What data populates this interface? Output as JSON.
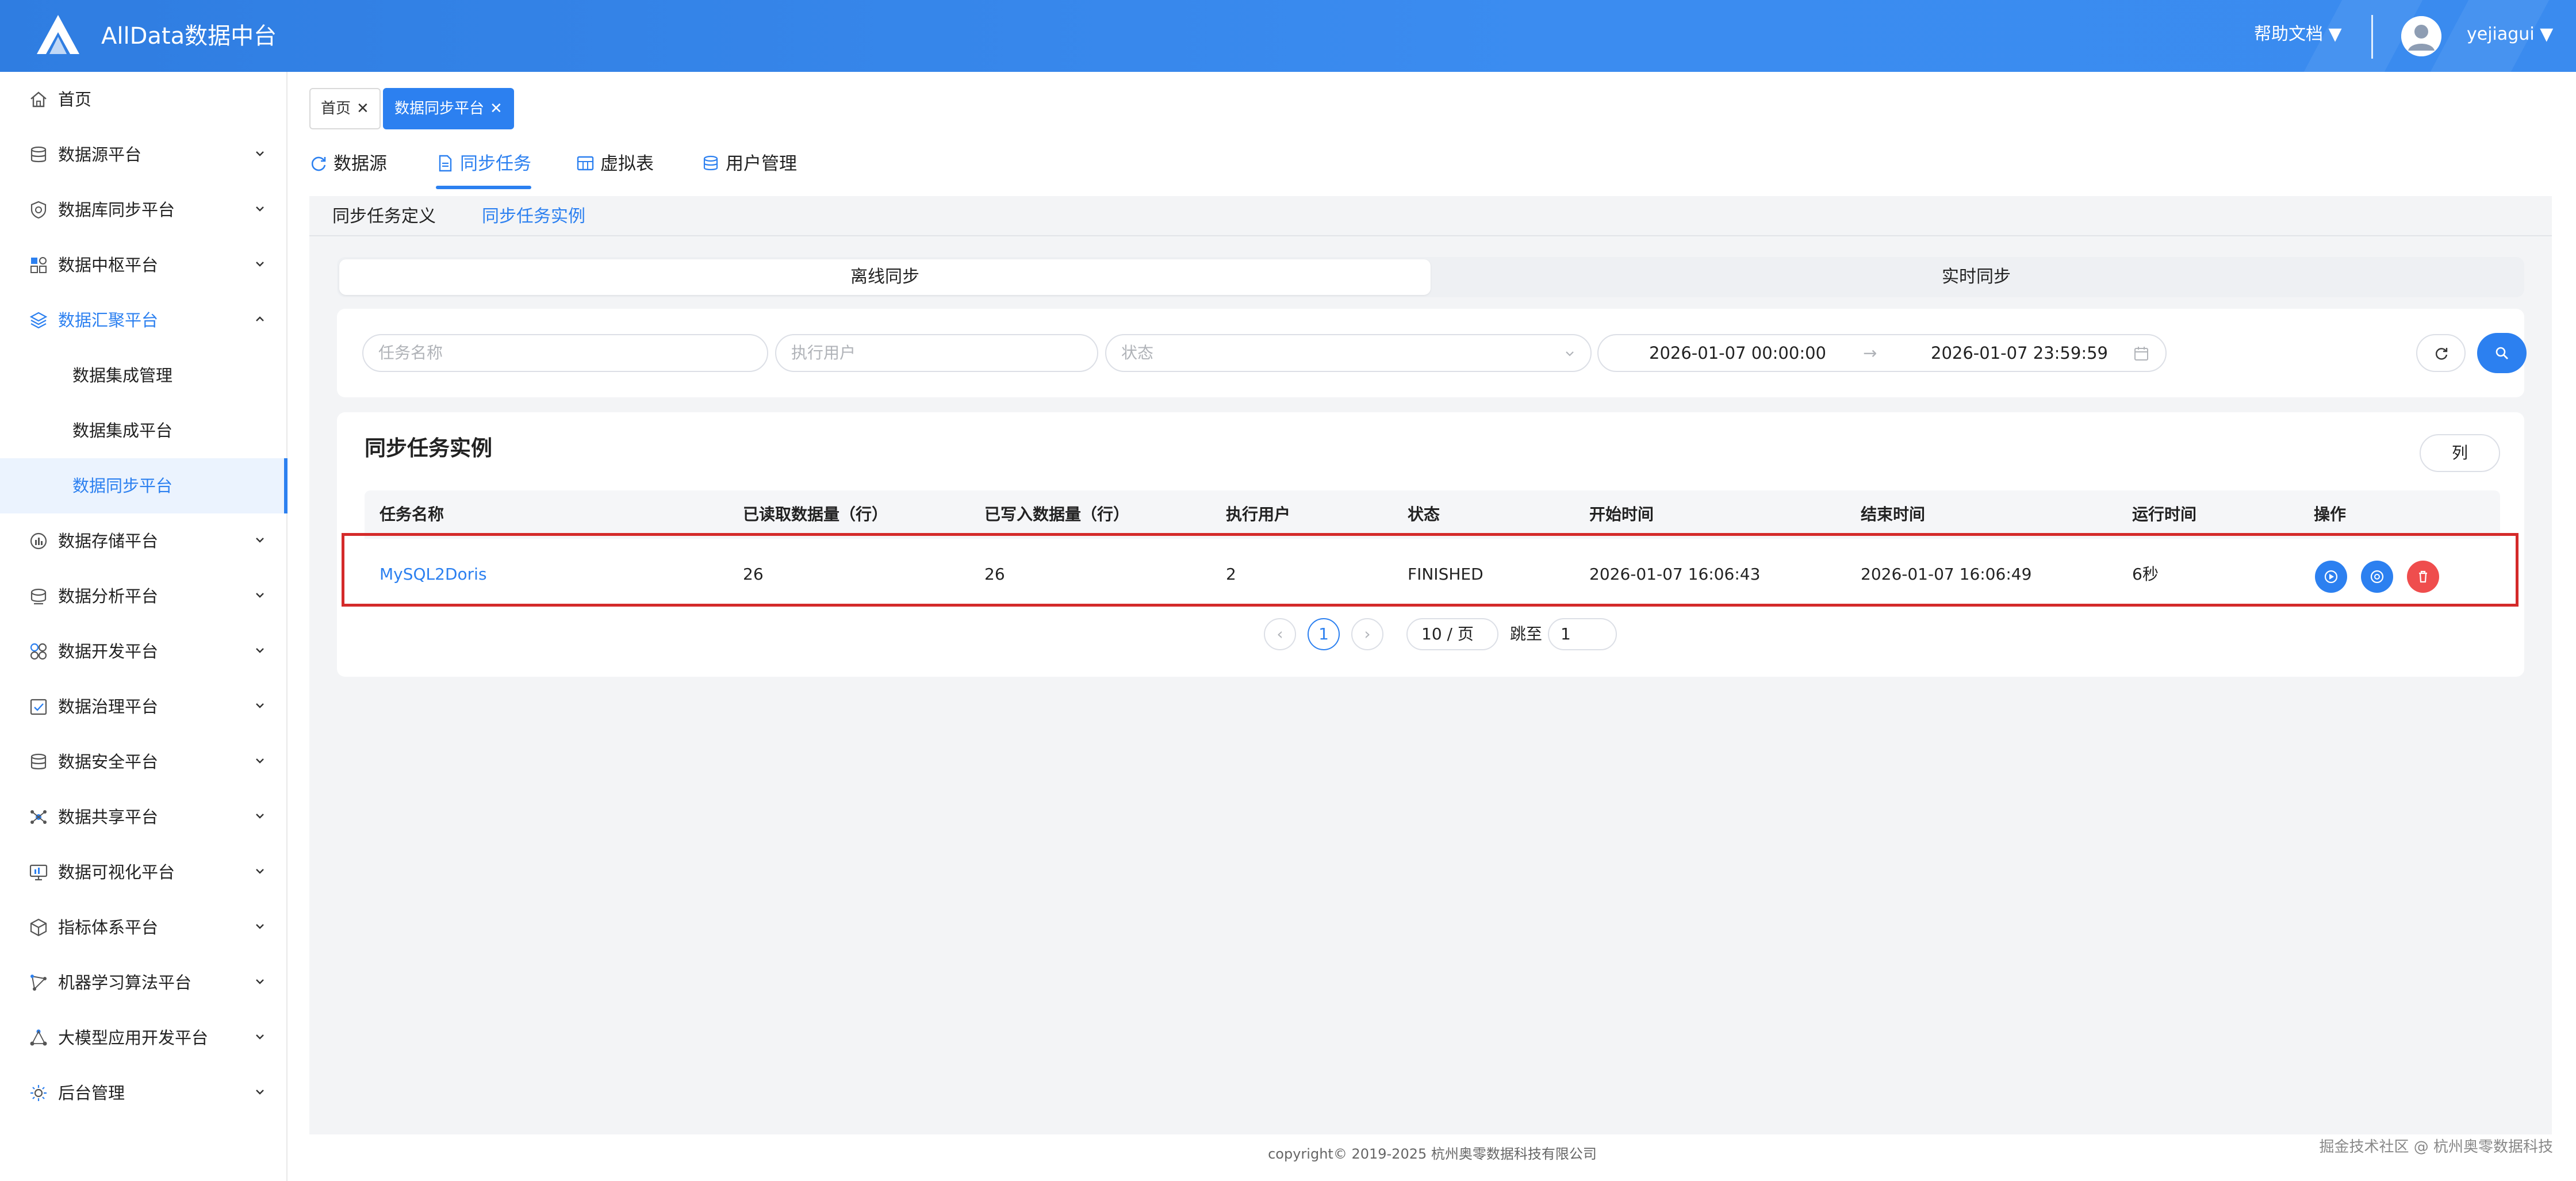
{
  "header": {
    "app_title": "AllData数据中台",
    "help_label": "帮助文档 ▼",
    "username_label": "yejiagui ▼"
  },
  "sidebar": {
    "items": [
      {
        "label": "首页",
        "icon": "home-icon"
      },
      {
        "label": "数据源平台",
        "icon": "database-icon"
      },
      {
        "label": "数据库同步平台",
        "icon": "shield-icon"
      },
      {
        "label": "数据中枢平台",
        "icon": "grid-icon"
      },
      {
        "label": "数据汇聚平台",
        "icon": "layers-icon",
        "open": true
      },
      {
        "label": "数据集成管理",
        "sub": true
      },
      {
        "label": "数据集成平台",
        "sub": true
      },
      {
        "label": "数据同步平台",
        "sub": true,
        "active": true
      },
      {
        "label": "数据存储平台",
        "icon": "storage-icon"
      },
      {
        "label": "数据分析平台",
        "icon": "analysis-icon"
      },
      {
        "label": "数据开发平台",
        "icon": "apps-icon"
      },
      {
        "label": "数据治理平台",
        "icon": "governance-icon"
      },
      {
        "label": "数据安全平台",
        "icon": "security-icon"
      },
      {
        "label": "数据共享平台",
        "icon": "share-icon"
      },
      {
        "label": "数据可视化平台",
        "icon": "monitor-icon"
      },
      {
        "label": "指标体系平台",
        "icon": "cube-icon"
      },
      {
        "label": "机器学习算法平台",
        "icon": "ml-icon"
      },
      {
        "label": "大模型应用开发平台",
        "icon": "model-icon"
      },
      {
        "label": "后台管理",
        "icon": "settings-icon"
      }
    ]
  },
  "tags": [
    {
      "label": "首页",
      "close": "✕"
    },
    {
      "label": "数据同步平台",
      "close": "✕"
    }
  ],
  "topnav": [
    {
      "label": "数据源"
    },
    {
      "label": "同步任务"
    },
    {
      "label": "虚拟表"
    },
    {
      "label": "用户管理"
    }
  ],
  "subtabs": [
    {
      "label": "同步任务定义"
    },
    {
      "label": "同步任务实例"
    }
  ],
  "segment": {
    "offline": "离线同步",
    "realtime": "实时同步"
  },
  "filters": {
    "task_name_placeholder": "任务名称",
    "exec_user_placeholder": "执行用户",
    "status_placeholder": "状态",
    "start_date": "2026-01-07 00:00:00",
    "arrow": "→",
    "end_date": "2026-01-07 23:59:59"
  },
  "table": {
    "title": "同步任务实例",
    "columns_button": "列",
    "headers": [
      "任务名称",
      "已读取数据量（行）",
      "已写入数据量（行）",
      "执行用户",
      "状态",
      "开始时间",
      "结束时间",
      "运行时间",
      "操作"
    ],
    "rows": [
      [
        "MySQL2Doris",
        "26",
        "26",
        "2",
        "FINISHED",
        "2026-01-07 16:06:43",
        "2026-01-07 16:06:49",
        "6秒"
      ]
    ],
    "op_colors": [
      "#2c80f0",
      "#2c80f0",
      "#ef4d4d"
    ]
  },
  "pagination": {
    "prev": "‹",
    "current_page": "1",
    "next": "›",
    "page_size": "10 / 页",
    "jump_label": "跳至",
    "jump_value": "1"
  },
  "footer": {
    "copyright": "copyright© 2019-2025 杭州奥零数据科技有限公司",
    "watermark": "掘金技术社区 @ 杭州奥零数据科技"
  },
  "colors": {
    "accent": "#2c80f0",
    "danger": "#ef4d4d",
    "highlight_border": "#d42a2a"
  }
}
